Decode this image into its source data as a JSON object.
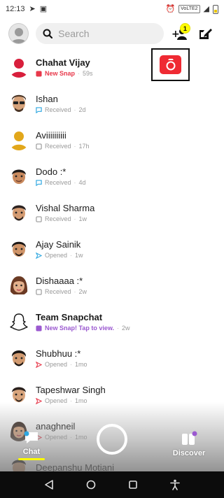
{
  "status_bar": {
    "time": "12:13",
    "network_badge": "VoLTE2"
  },
  "header": {
    "search_placeholder": "Search",
    "friend_request_count": "1"
  },
  "chats": [
    {
      "name": "Chahat Vijay",
      "status": "New Snap",
      "status_kind": "new-snap",
      "time": "59s",
      "bold": true,
      "avatar": "avatar-red"
    },
    {
      "name": "Ishan",
      "status": "Received",
      "status_kind": "received-chat",
      "time": "2d",
      "bold": false,
      "avatar": "bitmoji-sunglasses"
    },
    {
      "name": "Aviiiiiiiiii",
      "status": "Received",
      "status_kind": "received-snap",
      "time": "17h",
      "bold": false,
      "avatar": "avatar-yellow"
    },
    {
      "name": "Dodo :*",
      "status": "Received",
      "status_kind": "received-chat",
      "time": "4d",
      "bold": false,
      "avatar": "bitmoji"
    },
    {
      "name": "Vishal Sharma",
      "status": "Received",
      "status_kind": "received-snap",
      "time": "1w",
      "bold": false,
      "avatar": "bitmoji"
    },
    {
      "name": "Ajay Sainik",
      "status": "Opened",
      "status_kind": "opened-chat",
      "time": "1w",
      "bold": false,
      "avatar": "bitmoji"
    },
    {
      "name": "Dishaaaa :*",
      "status": "Received",
      "status_kind": "received-snap",
      "time": "2w",
      "bold": false,
      "avatar": "bitmoji-female"
    },
    {
      "name": "Team Snapchat",
      "status": "New Snap! Tap to view.",
      "status_kind": "new-snap-purple",
      "time": "2w",
      "bold": true,
      "avatar": "ghost"
    },
    {
      "name": "Shubhuu :*",
      "status": "Opened",
      "status_kind": "opened-snap",
      "time": "1mo",
      "bold": false,
      "avatar": "bitmoji"
    },
    {
      "name": "Tapeshwar Singh",
      "status": "Opened",
      "status_kind": "opened-snap",
      "time": "1mo",
      "bold": false,
      "avatar": "bitmoji"
    },
    {
      "name": "anaghneil",
      "status": "Opened",
      "status_kind": "opened-snap",
      "time": "1mo",
      "bold": false,
      "avatar": "bitmoji-female"
    },
    {
      "name": "Deepanshu Motiani",
      "status": "",
      "status_kind": "",
      "time": "",
      "bold": false,
      "avatar": "bitmoji"
    }
  ],
  "bottom_nav": {
    "chat_label": "Chat",
    "discover_label": "Discover"
  },
  "colors": {
    "snap_red": "#ef2a33",
    "new_snap_red": "#e8394b",
    "received_chat_blue": "#2fa7e0",
    "opened_red": "#e8394b",
    "purple": "#9b59d0",
    "snap_yellow": "#fffc00"
  }
}
